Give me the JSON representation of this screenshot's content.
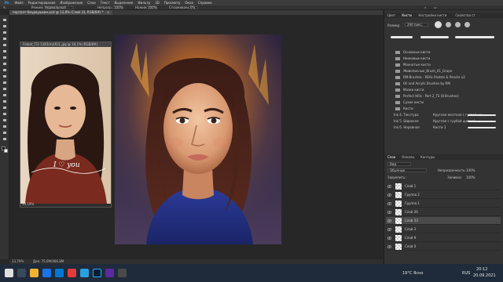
{
  "app": {
    "menu": [
      "Файл",
      "Редактирование",
      "Изображение",
      "Слои",
      "Текст",
      "Выделение",
      "Фильтр",
      "3D",
      "Просмотр",
      "Окно",
      "Справка"
    ],
    "document_tab": "портрет-бмурвушкин.psd @ 13,8% (Слой 33, RGB/8#) *",
    "options": {
      "mode_label": "Режим:",
      "mode_value": "Нормальный",
      "opacity_label": "Непрозр.:",
      "opacity_value": "100%",
      "flow_label": "Нажим:",
      "flow_value": "100%",
      "smoothing_label": "Сглаживание:",
      "smoothing_value": "0%"
    },
    "floating_window": {
      "title": "Fotoot_Ti1-1345(m)(6)1_jpg @ 10,1% (RGB/8#)",
      "zoom": "10,19%",
      "overlay_text": "I ♡ you"
    },
    "status": {
      "zoom": "13,79%",
      "doc": "Док: 75,6M/466,8M"
    }
  },
  "panel": {
    "top_tabs": [
      "Цвет",
      "Кисти",
      "Настройки кисти",
      "Свойства ст"
    ],
    "active_top_tab": "Кисти",
    "size_label": "Размер:",
    "size_value": "290 пикс.",
    "brush_groups": [
      "Основные кисти",
      "Неоновые кисти",
      "Мохнатые кисти",
      "Живописные_Brush_01_Grape",
      "RM-Brushes - REAL Pastels & Pencils v2",
      "Oil and Acrylic Brushes by RM",
      "Мазки кисти",
      "Perfect Hills - Part 2_TS (8 Brushes)",
      "Сухие кисти",
      "Кисти"
    ],
    "brush_items": [
      "Ink 4. Текстура",
      "Круглая жесткая с густой ща...",
      "Ink 5. Широкая",
      "Круглая с грубой щеткой",
      "Ink 6. Неровная",
      "Кисти 1"
    ],
    "layers_tabs": [
      "Слои",
      "Каналы",
      "Контуры"
    ],
    "layer_controls": {
      "kind": "Вид",
      "blend": "Обычные",
      "opacity_label": "Непрозрачность:",
      "opacity_value": "100%",
      "lock_label": "Закрепить:",
      "fill_label": "Заливка:",
      "fill_value": "100%"
    },
    "layers": [
      {
        "name": "Слой 1"
      },
      {
        "name": "Группа 2"
      },
      {
        "name": "Группа 1"
      },
      {
        "name": "Слой 36"
      },
      {
        "name": "Слой 33",
        "selected": true
      },
      {
        "name": "Слой 3"
      },
      {
        "name": "Слой 9"
      },
      {
        "name": "Слой 0"
      }
    ]
  },
  "taskbar": {
    "weather": "19°C Ясно",
    "time": "20:12",
    "date": "20.09.2021",
    "lang": "RUS"
  },
  "colors": {
    "canvas_bg": "#272727",
    "panel_bg": "#333333",
    "taskbar_bg": "#1f2b3a",
    "accent": "#31a8ff"
  },
  "icons": [
    "move-icon",
    "marquee-icon",
    "lasso-icon",
    "quick-select-icon",
    "crop-icon",
    "eyedropper-icon",
    "healing-icon",
    "brush-icon",
    "stamp-icon",
    "history-brush-icon",
    "eraser-icon",
    "gradient-icon",
    "blur-icon",
    "dodge-icon",
    "pen-icon",
    "type-icon",
    "path-select-icon",
    "shape-icon",
    "hand-icon",
    "zoom-icon"
  ]
}
